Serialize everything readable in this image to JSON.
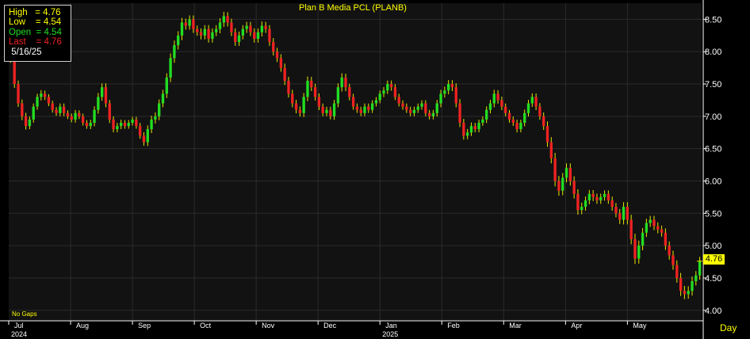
{
  "chart_data": {
    "type": "candlestick",
    "title": "Plan B Media PCL (PLANB)",
    "interval": "Day",
    "gaps_note": "No Gaps",
    "yticks": [
      "8.50",
      "8.00",
      "7.50",
      "7.00",
      "6.50",
      "6.00",
      "5.50",
      "5.00",
      "4.50",
      "4.00"
    ],
    "ylim": [
      3.85,
      8.75
    ],
    "months": [
      "Jul",
      "Aug",
      "Sep",
      "Oct",
      "Nov",
      "Dec",
      "Jan",
      "Feb",
      "Mar",
      "Apr",
      "May"
    ],
    "years": [
      {
        "label": "2024",
        "month": "Jul"
      },
      {
        "label": "2025",
        "month": "Jan"
      }
    ],
    "info": {
      "high_label": "High",
      "high_value": "4.76",
      "low_label": "Low",
      "low_value": "4.54",
      "open_label": "Open",
      "open_value": "4.54",
      "last_label": "Last",
      "last_value": "4.76",
      "date": "5/16/25"
    },
    "last_price": "4.76",
    "closes": [
      7.9,
      7.5,
      7.2,
      7.0,
      6.85,
      6.95,
      7.15,
      7.3,
      7.35,
      7.3,
      7.2,
      7.1,
      7.05,
      7.15,
      7.05,
      7.0,
      6.95,
      7.05,
      7.0,
      6.9,
      6.85,
      6.9,
      7.1,
      7.3,
      7.45,
      7.2,
      6.95,
      6.8,
      6.85,
      6.9,
      6.85,
      6.9,
      6.95,
      6.85,
      6.7,
      6.6,
      6.8,
      6.95,
      7.0,
      7.2,
      7.35,
      7.6,
      7.9,
      8.1,
      8.25,
      8.45,
      8.4,
      8.5,
      8.35,
      8.3,
      8.25,
      8.35,
      8.2,
      8.3,
      8.35,
      8.45,
      8.55,
      8.45,
      8.3,
      8.15,
      8.25,
      8.35,
      8.4,
      8.3,
      8.2,
      8.3,
      8.4,
      8.35,
      8.15,
      8.0,
      7.9,
      7.75,
      7.55,
      7.35,
      7.2,
      7.1,
      7.05,
      7.3,
      7.55,
      7.45,
      7.3,
      7.15,
      7.05,
      7.1,
      7.0,
      7.2,
      7.45,
      7.6,
      7.45,
      7.3,
      7.15,
      7.1,
      7.05,
      7.15,
      7.1,
      7.2,
      7.25,
      7.35,
      7.4,
      7.5,
      7.45,
      7.3,
      7.2,
      7.15,
      7.1,
      7.05,
      7.1,
      7.15,
      7.2,
      7.05,
      7.0,
      7.05,
      7.2,
      7.35,
      7.4,
      7.5,
      7.45,
      7.2,
      6.9,
      6.7,
      6.75,
      6.85,
      6.8,
      6.9,
      6.95,
      7.1,
      7.2,
      7.35,
      7.25,
      7.15,
      7.05,
      6.95,
      6.9,
      6.8,
      6.9,
      7.05,
      7.2,
      7.3,
      7.15,
      7.0,
      6.85,
      6.6,
      6.35,
      6.0,
      5.85,
      6.05,
      6.2,
      6.0,
      5.8,
      5.55,
      5.6,
      5.7,
      5.8,
      5.75,
      5.7,
      5.75,
      5.8,
      5.7,
      5.6,
      5.5,
      5.4,
      5.6,
      5.4,
      5.1,
      4.8,
      5.0,
      5.2,
      5.35,
      5.4,
      5.3,
      5.25,
      5.2,
      5.0,
      4.85,
      4.7,
      4.5,
      4.3,
      4.25,
      4.3,
      4.45,
      4.54,
      4.76
    ],
    "volatility": [
      0.12,
      0.1,
      0.09,
      0.1,
      0.09,
      0.08,
      0.08,
      0.08,
      0.09,
      0.08,
      0.07,
      0.07,
      0.07,
      0.08,
      0.08,
      0.07,
      0.07,
      0.08,
      0.07,
      0.07,
      0.07,
      0.08,
      0.09,
      0.1,
      0.1,
      0.1,
      0.09,
      0.08,
      0.08,
      0.08,
      0.07,
      0.07,
      0.07,
      0.07,
      0.08,
      0.09,
      0.1,
      0.1,
      0.1,
      0.1,
      0.1,
      0.11,
      0.12,
      0.12,
      0.11,
      0.12,
      0.1,
      0.1,
      0.1,
      0.09,
      0.1,
      0.1,
      0.1,
      0.1,
      0.1,
      0.11,
      0.11,
      0.1,
      0.1,
      0.1,
      0.1,
      0.1,
      0.1,
      0.1,
      0.1,
      0.1,
      0.11,
      0.1,
      0.1,
      0.1,
      0.1,
      0.1,
      0.11,
      0.1,
      0.1,
      0.09,
      0.09,
      0.1,
      0.11,
      0.1,
      0.09,
      0.09,
      0.08,
      0.08,
      0.08,
      0.09,
      0.1,
      0.11,
      0.1,
      0.09,
      0.08,
      0.08,
      0.08,
      0.08,
      0.08,
      0.08,
      0.08,
      0.08,
      0.09,
      0.09,
      0.09,
      0.08,
      0.08,
      0.08,
      0.08,
      0.08,
      0.08,
      0.08,
      0.08,
      0.08,
      0.08,
      0.08,
      0.09,
      0.1,
      0.1,
      0.1,
      0.1,
      0.1,
      0.11,
      0.1,
      0.09,
      0.09,
      0.08,
      0.08,
      0.08,
      0.09,
      0.09,
      0.1,
      0.09,
      0.09,
      0.08,
      0.08,
      0.08,
      0.08,
      0.08,
      0.09,
      0.09,
      0.09,
      0.09,
      0.09,
      0.1,
      0.12,
      0.13,
      0.14,
      0.13,
      0.12,
      0.12,
      0.12,
      0.12,
      0.12,
      0.11,
      0.1,
      0.1,
      0.1,
      0.09,
      0.09,
      0.09,
      0.09,
      0.1,
      0.1,
      0.11,
      0.12,
      0.12,
      0.13,
      0.14,
      0.13,
      0.12,
      0.11,
      0.1,
      0.1,
      0.1,
      0.1,
      0.11,
      0.11,
      0.12,
      0.12,
      0.13,
      0.13,
      0.12,
      0.12,
      0.11,
      0.11,
      0.12
    ],
    "grid": true,
    "colors": {
      "background": "#000000",
      "plot_background": "#121212",
      "grid": "#2b2b2b",
      "up": "#22dd22",
      "down": "#ee2222",
      "wick": "#e6e600",
      "text": "#ffffff",
      "title": "#ffff00",
      "info_high": "#ffff00",
      "info_low": "#ffff00",
      "info_open": "#22dd22",
      "info_last": "#ee2222",
      "info_date": "#ffffff"
    }
  }
}
